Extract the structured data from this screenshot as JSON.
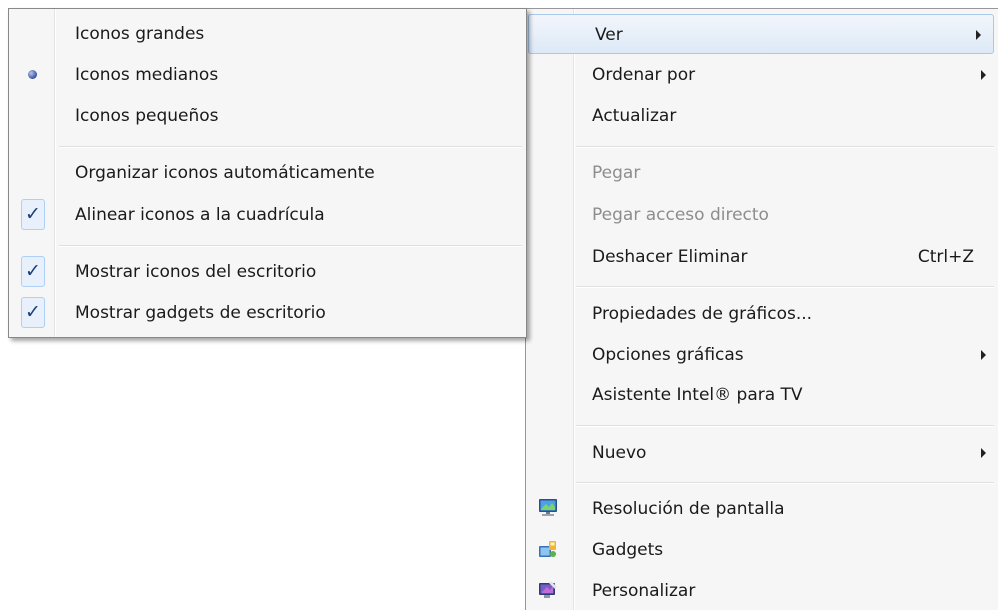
{
  "main_menu": {
    "items": [
      {
        "label": "Ver"
      },
      {
        "label": "Ordenar por"
      },
      {
        "label": "Actualizar"
      },
      {
        "label": "Pegar"
      },
      {
        "label": "Pegar acceso directo"
      },
      {
        "label": "Deshacer Eliminar",
        "shortcut": "Ctrl+Z"
      },
      {
        "label": "Propiedades de gráficos..."
      },
      {
        "label": "Opciones gráficas"
      },
      {
        "label": "Asistente Intel® para TV"
      },
      {
        "label": "Nuevo"
      },
      {
        "label": "Resolución de pantalla",
        "icon": "monitor-display-icon"
      },
      {
        "label": "Gadgets",
        "icon": "gadgets-icon"
      },
      {
        "label": "Personalizar",
        "icon": "personalize-icon"
      }
    ]
  },
  "sub_menu": {
    "items": [
      {
        "label": "Iconos grandes"
      },
      {
        "label": "Iconos medianos",
        "state": "radio-selected"
      },
      {
        "label": "Iconos pequeños"
      },
      {
        "label": "Organizar iconos automáticamente"
      },
      {
        "label": "Alinear iconos a la cuadrícula",
        "state": "checked"
      },
      {
        "label": "Mostrar iconos del escritorio",
        "state": "checked"
      },
      {
        "label": "Mostrar gadgets de escritorio",
        "state": "checked"
      }
    ]
  },
  "glyphs": {
    "check": "✓"
  },
  "colors": {
    "highlight_border": "#a8c8ec",
    "disabled_text": "#8d8d8d",
    "checkmark": "#1a3f7a"
  }
}
